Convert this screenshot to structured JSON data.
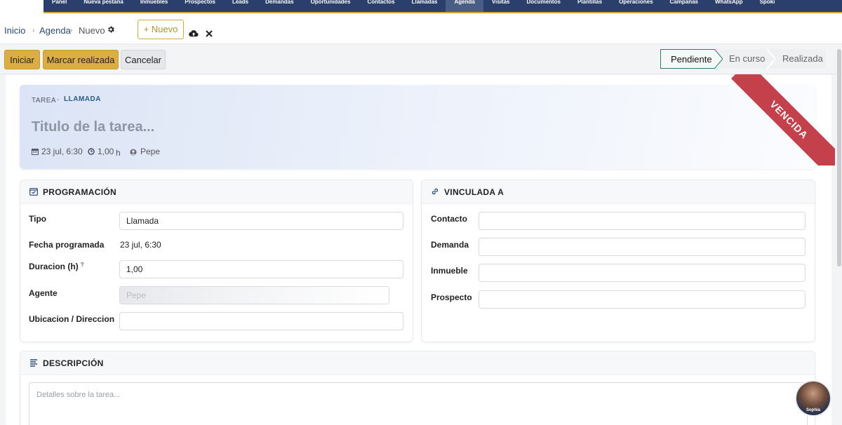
{
  "nav": {
    "items": [
      "Panel",
      "Nueva pestaña",
      "Inmuebles",
      "Prospectos",
      "Leads",
      "Demandas",
      "Oportunidades",
      "Contactos",
      "Llamadas",
      "Agenda",
      "Visitas",
      "Documentos",
      "Plantillas",
      "Operaciones",
      "Campañas",
      "WhatsApp",
      "Spoki"
    ],
    "active": "Agenda"
  },
  "breadcrumb": {
    "home": "Inicio",
    "section": "Agenda",
    "current": "Nuevo",
    "sep": "›"
  },
  "toolbar": {
    "new_label": "+ Nuevo"
  },
  "actions": {
    "start": "Iniciar",
    "mark_done": "Marcar realizada",
    "cancel": "Cancelar"
  },
  "status_steps": [
    "Pendiente",
    "En curso",
    "Realizada"
  ],
  "header": {
    "kind": "TAREA",
    "dash": "-",
    "type": "LLAMADA",
    "title_placeholder": "Titulo de la tarea...",
    "date": "23 jul, 6:30",
    "duration": "1,00",
    "duration_unit": "h",
    "agent": "Pepe",
    "ribbon": "VENCIDA"
  },
  "programacion": {
    "title": "PROGRAMACIÓN",
    "tipo_label": "Tipo",
    "tipo_value": "Llamada",
    "fecha_label": "Fecha programada",
    "fecha_value": "23 jul, 6:30",
    "duracion_label": "Duracion (h)",
    "duracion_help": "?",
    "duracion_value": "1,00",
    "agente_label": "Agente",
    "agente_value": "Pepe",
    "ubicacion_label": "Ubicacion / Direccion",
    "ubicacion_value": ""
  },
  "vinculada": {
    "title": "VINCULADA A",
    "contacto_label": "Contacto",
    "demanda_label": "Demanda",
    "inmueble_label": "Inmueble",
    "prospecto_label": "Prospecto"
  },
  "descripcion": {
    "title": "DESCRIPCIÓN",
    "placeholder": "Detalles sobre la tarea..."
  },
  "assistant": {
    "label": "Sophia"
  },
  "colors": {
    "nav_bg": "#2a3f6b",
    "accent_gold": "#dcae42",
    "ribbon_red": "#c4404a",
    "step_active_border": "#2c7a72"
  }
}
